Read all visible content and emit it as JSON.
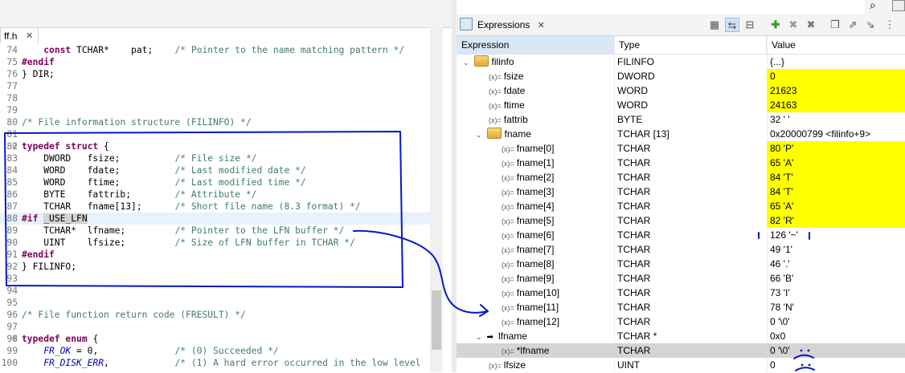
{
  "editor": {
    "tab_label": "ff.h",
    "tab_close": "✕",
    "lines": [
      {
        "n": "74",
        "t": "    const TCHAR*    pat;    /* Pointer to the name matching pattern */"
      },
      {
        "n": "75",
        "t": "#endif"
      },
      {
        "n": "76",
        "t": "} DIR;"
      },
      {
        "n": "77",
        "t": ""
      },
      {
        "n": "78",
        "t": ""
      },
      {
        "n": "79",
        "t": ""
      },
      {
        "n": "80",
        "t": "/* File information structure (FILINFO) */"
      },
      {
        "n": "81",
        "t": ""
      },
      {
        "n": "82",
        "t": "typedef struct {"
      },
      {
        "n": "83",
        "t": "    DWORD   fsize;          /* File size */"
      },
      {
        "n": "84",
        "t": "    WORD    fdate;          /* Last modified date */"
      },
      {
        "n": "85",
        "t": "    WORD    ftime;          /* Last modified time */"
      },
      {
        "n": "86",
        "t": "    BYTE    fattrib;        /* Attribute */"
      },
      {
        "n": "87",
        "t": "    TCHAR   fname[13];      /* Short file name (8.3 format) */"
      },
      {
        "n": "88",
        "t": "#if _USE_LFN"
      },
      {
        "n": "89",
        "t": "    TCHAR*  lfname;         /* Pointer to the LFN buffer */"
      },
      {
        "n": "90",
        "t": "    UINT    lfsize;         /* Size of LFN buffer in TCHAR */"
      },
      {
        "n": "91",
        "t": "#endif"
      },
      {
        "n": "92",
        "t": "} FILINFO;"
      },
      {
        "n": "93",
        "t": ""
      },
      {
        "n": "94",
        "t": ""
      },
      {
        "n": "95",
        "t": ""
      },
      {
        "n": "96",
        "t": "/* File function return code (FRESULT) */"
      },
      {
        "n": "97",
        "t": ""
      },
      {
        "n": "98",
        "t": "typedef enum {"
      },
      {
        "n": "99",
        "t": "    FR_OK = 0,              /* (0) Succeeded */"
      },
      {
        "n": "100",
        "t": "    FR_DISK_ERR,            /* (1) A hard error occurred in the low level"
      }
    ]
  },
  "expressions": {
    "view_title": "Expressions",
    "view_close": "✕",
    "columns": [
      "Expression",
      "Type",
      "Value"
    ],
    "rows": [
      {
        "name": "filinfo",
        "type": "FILINFO",
        "value": "{...}",
        "level": 0,
        "kind": "struct",
        "twisty": "v",
        "changed": false
      },
      {
        "name": "fsize",
        "type": "DWORD",
        "value": "0",
        "level": 1,
        "kind": "var",
        "twisty": "",
        "changed": true
      },
      {
        "name": "fdate",
        "type": "WORD",
        "value": "21623",
        "level": 1,
        "kind": "var",
        "twisty": "",
        "changed": true
      },
      {
        "name": "ftime",
        "type": "WORD",
        "value": "24163",
        "level": 1,
        "kind": "var",
        "twisty": "",
        "changed": true
      },
      {
        "name": "fattrib",
        "type": "BYTE",
        "value": "32 ' '",
        "level": 1,
        "kind": "var",
        "twisty": "",
        "changed": false
      },
      {
        "name": "fname",
        "type": "TCHAR [13]",
        "value": "0x20000799 <filinfo+9>",
        "level": 1,
        "kind": "struct",
        "twisty": "v",
        "changed": false
      },
      {
        "name": "fname[0]",
        "type": "TCHAR",
        "value": "80 'P'",
        "level": 2,
        "kind": "var",
        "twisty": "",
        "changed": true
      },
      {
        "name": "fname[1]",
        "type": "TCHAR",
        "value": "65 'A'",
        "level": 2,
        "kind": "var",
        "twisty": "",
        "changed": true
      },
      {
        "name": "fname[2]",
        "type": "TCHAR",
        "value": "84 'T'",
        "level": 2,
        "kind": "var",
        "twisty": "",
        "changed": true
      },
      {
        "name": "fname[3]",
        "type": "TCHAR",
        "value": "84 'T'",
        "level": 2,
        "kind": "var",
        "twisty": "",
        "changed": true
      },
      {
        "name": "fname[4]",
        "type": "TCHAR",
        "value": "65 'A'",
        "level": 2,
        "kind": "var",
        "twisty": "",
        "changed": true
      },
      {
        "name": "fname[5]",
        "type": "TCHAR",
        "value": "82 'R'",
        "level": 2,
        "kind": "var",
        "twisty": "",
        "changed": true
      },
      {
        "name": "fname[6]",
        "type": "TCHAR",
        "value": "126 '~'",
        "level": 2,
        "kind": "var",
        "twisty": "",
        "changed": false
      },
      {
        "name": "fname[7]",
        "type": "TCHAR",
        "value": "49 '1'",
        "level": 2,
        "kind": "var",
        "twisty": "",
        "changed": false
      },
      {
        "name": "fname[8]",
        "type": "TCHAR",
        "value": "46 '.'",
        "level": 2,
        "kind": "var",
        "twisty": "",
        "changed": false
      },
      {
        "name": "fname[9]",
        "type": "TCHAR",
        "value": "66 'B'",
        "level": 2,
        "kind": "var",
        "twisty": "",
        "changed": false
      },
      {
        "name": "fname[10]",
        "type": "TCHAR",
        "value": "73 'I'",
        "level": 2,
        "kind": "var",
        "twisty": "",
        "changed": false
      },
      {
        "name": "fname[11]",
        "type": "TCHAR",
        "value": "78 'N'",
        "level": 2,
        "kind": "var",
        "twisty": "",
        "changed": false
      },
      {
        "name": "fname[12]",
        "type": "TCHAR",
        "value": "0 '\\0'",
        "level": 2,
        "kind": "var",
        "twisty": "",
        "changed": false
      },
      {
        "name": "lfname",
        "type": "TCHAR *",
        "value": "0x0",
        "level": 1,
        "kind": "ptr",
        "twisty": "v",
        "changed": false
      },
      {
        "name": "*lfname",
        "type": "TCHAR",
        "value": "0 '\\0'",
        "level": 2,
        "kind": "var",
        "twisty": "",
        "changed": false,
        "selected": true
      },
      {
        "name": "lfsize",
        "type": "UINT",
        "value": "0",
        "level": 1,
        "kind": "var",
        "twisty": "",
        "changed": false
      }
    ]
  },
  "icons": {
    "toolbar": [
      "show-type-names-icon",
      "show-logical-structure-icon",
      "collapse-all-icon",
      "add-expression-icon",
      "remove-expression-icon",
      "remove-all-icon",
      "new-watch-icon",
      "export-icon",
      "import-icon",
      "view-menu-icon"
    ],
    "search": "search-icon"
  },
  "colors": {
    "changed_value": "#ffff00",
    "keyword": "#7f0055",
    "comment": "#3f7f5f",
    "annotation_ink": "#0019c8",
    "selected_row": "#d4d4d4"
  }
}
